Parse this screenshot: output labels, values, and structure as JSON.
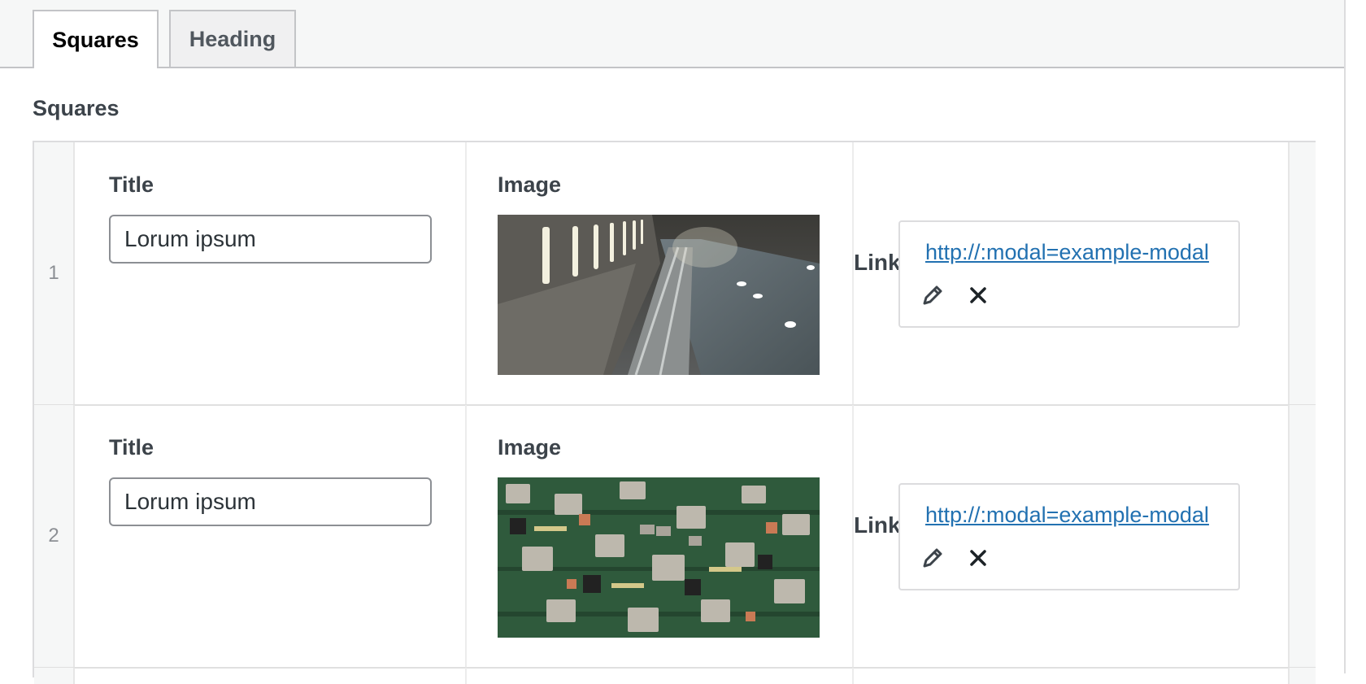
{
  "tabs": [
    {
      "label": "Squares",
      "active": true
    },
    {
      "label": "Heading",
      "active": false
    }
  ],
  "section": {
    "label": "Squares"
  },
  "rows": [
    {
      "index": "1",
      "title_label": "Title",
      "title_value": "Lorum ipsum",
      "image_label": "Image",
      "image_icon": "industrial-tunnel-photo",
      "link_label": "Link",
      "link_url": "http://:modal=example-modal",
      "edit_icon": "pencil-icon",
      "remove_icon": "close-icon"
    },
    {
      "index": "2",
      "title_label": "Title",
      "title_value": "Lorum ipsum",
      "image_label": "Image",
      "image_icon": "circuit-board-photo",
      "link_label": "Link",
      "link_url": "http://:modal=example-modal",
      "edit_icon": "pencil-icon",
      "remove_icon": "close-icon"
    }
  ],
  "colors": {
    "link": "#2271b1",
    "border": "#dcdcde",
    "tabbar_bg": "#f6f7f7"
  }
}
